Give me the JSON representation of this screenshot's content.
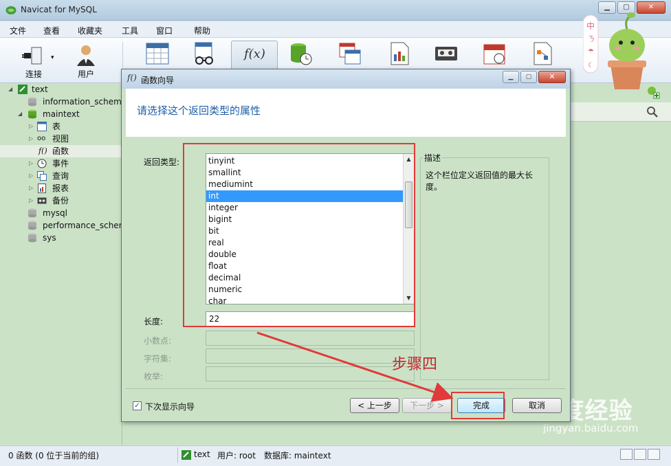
{
  "app": {
    "title": "Navicat for MySQL"
  },
  "menu": [
    "文件",
    "查看",
    "收藏夹",
    "工具",
    "窗口",
    "帮助"
  ],
  "toolbar": {
    "connect_label": "连接",
    "user_label": "用户",
    "fx_label": "f(x)"
  },
  "tree": {
    "connection": "text",
    "databases_top": [
      "information_schema",
      "maintext"
    ],
    "children": [
      "表",
      "视图",
      "函数",
      "事件",
      "查询",
      "报表",
      "备份"
    ],
    "databases_bottom": [
      "mysql",
      "performance_schema",
      "sys"
    ]
  },
  "dialog": {
    "icon_text": "f()",
    "title": "函数向导",
    "heading": "请选择这个返回类型的属性",
    "return_type_label": "返回类型:",
    "types": [
      "tinyint",
      "smallint",
      "mediumint",
      "int",
      "integer",
      "bigint",
      "bit",
      "real",
      "double",
      "float",
      "decimal",
      "numeric",
      "char"
    ],
    "selected_index": 3,
    "length_label": "长度:",
    "length_value": "22",
    "decimal_label": "小数点:",
    "charset_label": "字符集:",
    "enum_label": "枚举:",
    "desc_title": "描述",
    "desc_text": "这个栏位定义返回值的最大长度。",
    "show_next_time": "下次显示向导",
    "btn_prev": "< 上一步",
    "btn_next": "下一步 >",
    "btn_finish": "完成",
    "btn_cancel": "取消"
  },
  "annotation": {
    "step_text": "步骤四"
  },
  "status": {
    "left": "0 函数 (0 位于当前的组)",
    "conn": "text",
    "user": "用户: root",
    "db": "数据库: maintext"
  },
  "watermark": {
    "logo": "Bai度经验",
    "url": "jingyan.baidu.com"
  },
  "colors": {
    "panel_bg": "#cbe2c7",
    "heading_blue": "#1f5fa7",
    "selection": "#3399ff",
    "annotation_red": "#e03a3a"
  }
}
